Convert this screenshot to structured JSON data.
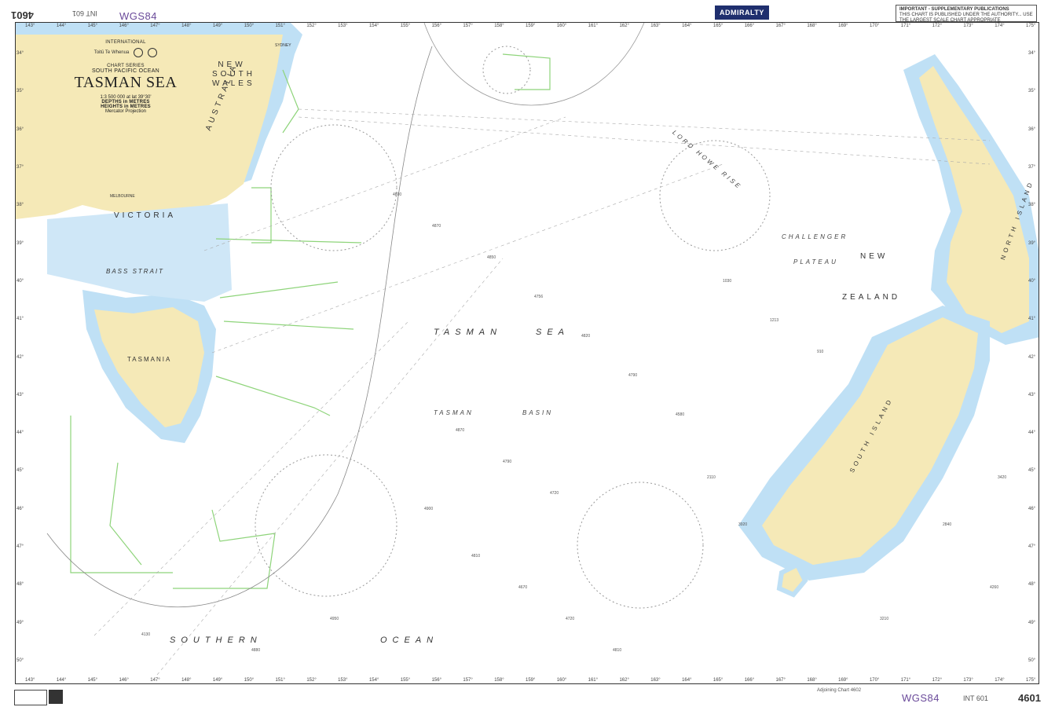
{
  "header": {
    "chart_number_flipped": "4601",
    "int_number_flipped": "INT 601",
    "datum": "WGS84",
    "brand": "ADMIRALTY",
    "notice_title": "IMPORTANT - SUPPLEMENTARY PUBLICATIONS",
    "notice_text": "THIS CHART IS PUBLISHED UNDER THE AUTHORITY... USE THE LARGEST SCALE CHART APPROPRIATE"
  },
  "footer": {
    "datum": "WGS84",
    "int_number": "INT 601",
    "chart_number": "4601",
    "adjoining_chart": "Adjoining Chart 4602"
  },
  "title_block": {
    "series": "INTERNATIONAL",
    "chart_series": "CHART SERIES",
    "region": "SOUTH PACIFIC OCEAN",
    "title": "TASMAN SEA",
    "scale": "1:3 500 000 at lat 39°30'",
    "depths": "DEPTHS in METRES",
    "heights": "HEIGHTS in METRES",
    "projection": "Mercator Projection",
    "logo_text": "Toitū Te Whenua"
  },
  "map_labels": {
    "new_south_wales": "NEW SOUTH WALES",
    "australia": "AUSTRALIA",
    "victoria": "VICTORIA",
    "bass_strait": "BASS STRAIT",
    "tasmania": "TASMANIA",
    "tasman_sea_1": "TASMAN",
    "tasman_sea_2": "SEA",
    "tasman_basin_1": "TASMAN",
    "tasman_basin_2": "BASIN",
    "southern": "SOUTHERN",
    "ocean": "OCEAN",
    "lord_howe_rise": "LORD HOWE RISE",
    "challenger": "CHALLENGER",
    "plateau": "PLATEAU",
    "new": "NEW",
    "zealand": "ZEALAND",
    "north_island": "NORTH ISLAND",
    "south_island": "SOUTH ISLAND",
    "melbourne": "MELBOURNE",
    "sydney": "SYDNEY"
  },
  "longitude_ticks": [
    "143°",
    "144°",
    "145°",
    "146°",
    "147°",
    "148°",
    "149°",
    "150°",
    "151°",
    "152°",
    "153°",
    "154°",
    "155°",
    "156°",
    "157°",
    "158°",
    "159°",
    "160°",
    "161°",
    "162°",
    "163°",
    "164°",
    "165°",
    "166°",
    "167°",
    "168°",
    "169°",
    "170°",
    "171°",
    "172°",
    "173°",
    "174°",
    "175°"
  ],
  "latitude_ticks": [
    "34°",
    "35°",
    "36°",
    "37°",
    "38°",
    "39°",
    "40°",
    "41°",
    "42°",
    "43°",
    "44°",
    "45°",
    "46°",
    "47°",
    "48°",
    "49°",
    "50°"
  ],
  "colors": {
    "land": "#f5e9b7",
    "shallow": "#bfe0f5",
    "deep_shallow": "#e2f1fb",
    "sea": "#ffffff",
    "limit_lines": "#8ed47a"
  }
}
